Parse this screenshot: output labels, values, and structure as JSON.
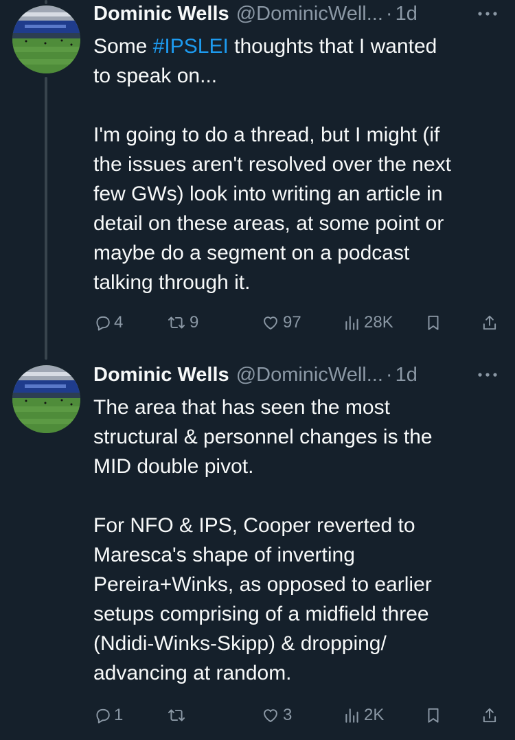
{
  "tweets": [
    {
      "author_name": "Dominic Wells",
      "handle": "@DominicWell...",
      "separator": "·",
      "time": "1d",
      "text_before": "Some ",
      "hashtag": "#IPSLEI",
      "text_after": " thoughts that I wanted\nto speak on...\n\nI'm going to do a thread, but I might (if\nthe issues aren't resolved over the next\nfew GWs) look into writing an article in\ndetail on these areas, at some point or\nmaybe do a segment on a podcast\ntalking through it.",
      "replies": "4",
      "retweets": "9",
      "likes": "97",
      "views": "28K"
    },
    {
      "author_name": "Dominic Wells",
      "handle": "@DominicWell...",
      "separator": "·",
      "time": "1d",
      "text": "The area that has seen the most\nstructural & personnel changes is the\nMID double pivot.\n\nFor NFO & IPS, Cooper reverted to\nMaresca's shape of inverting\nPereira+Winks, as opposed to earlier\nsetups comprising of a midfield three\n(Ndidi-Winks-Skipp) & dropping/\nadvancing at random.",
      "replies": "1",
      "retweets": "",
      "likes": "3",
      "views": "2K"
    }
  ],
  "icons": {
    "reply": "reply-icon",
    "retweet": "retweet-icon",
    "like": "like-icon",
    "views": "views-icon",
    "bookmark": "bookmark-icon",
    "share": "share-icon",
    "more": "more-icon"
  },
  "colors": {
    "background": "#15202b",
    "text": "#f7f9f9",
    "secondary": "#8b98a5",
    "link": "#1d9bf0",
    "thread_line": "#38444d"
  }
}
